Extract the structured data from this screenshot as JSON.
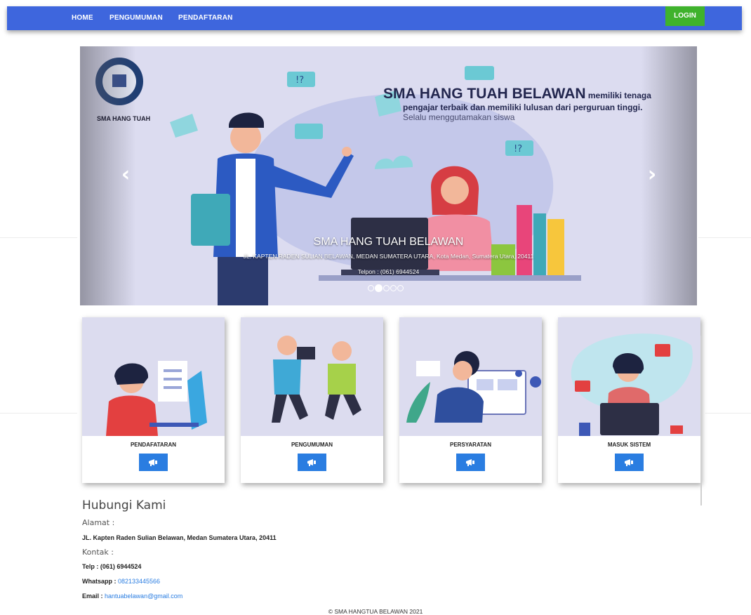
{
  "nav": {
    "items": [
      "HOME",
      "PENGUMUMAN",
      "PENDAFTARAN"
    ],
    "login_label": "LOGIN"
  },
  "carousel": {
    "logo_caption": "SMA HANG TUAH",
    "headline_big": "SMA HANG TUAH BELAWAN",
    "headline_small": " memiliki tenaga",
    "headline_line2": "pengajar terbaik dan memiliki lulusan dari perguruan tinggi.",
    "headline_line3": "Selalu menggutamakan siswa",
    "caption_title": "SMA HANG TUAH BELAWAN",
    "caption_address": "JL. KAPTEN RADEN SULIAN BELAWAN, MEDAN SUMATERA UTARA, Kota Medan, Sumatera Utara, 20411",
    "caption_phone": "Telpon : (061) 6944524",
    "prev_icon": "chevron-left-icon",
    "next_icon": "chevron-right-icon",
    "slide_count": 5,
    "active_slide": 2
  },
  "cards": [
    {
      "title": "PENDAFATARAN",
      "icon": "megaphone-icon"
    },
    {
      "title": "PENGUMUMAN",
      "icon": "megaphone-icon"
    },
    {
      "title": "PERSYARATAN",
      "icon": "megaphone-icon"
    },
    {
      "title": "MASUK SISTEM",
      "icon": "megaphone-icon"
    }
  ],
  "contact": {
    "title": "Hubungi Kami",
    "address_label": "Alamat :",
    "address": "JL. Kapten Raden Sulian Belawan, Medan Sumatera Utara, 20411",
    "contact_label": "Kontak :",
    "telp": "Telp : (061) 6944524",
    "whatsapp_label": "Whatsapp : ",
    "whatsapp": "082133445566",
    "email_label": "Email : ",
    "email": "hantuabelawan@gmail.com"
  },
  "footer": "© SMA HANGTUA BELAWAN 2021",
  "colors": {
    "navbar": "#3e66dd",
    "login": "#3fb22c",
    "card_button": "#2a7de1",
    "link": "#2a7de1"
  }
}
